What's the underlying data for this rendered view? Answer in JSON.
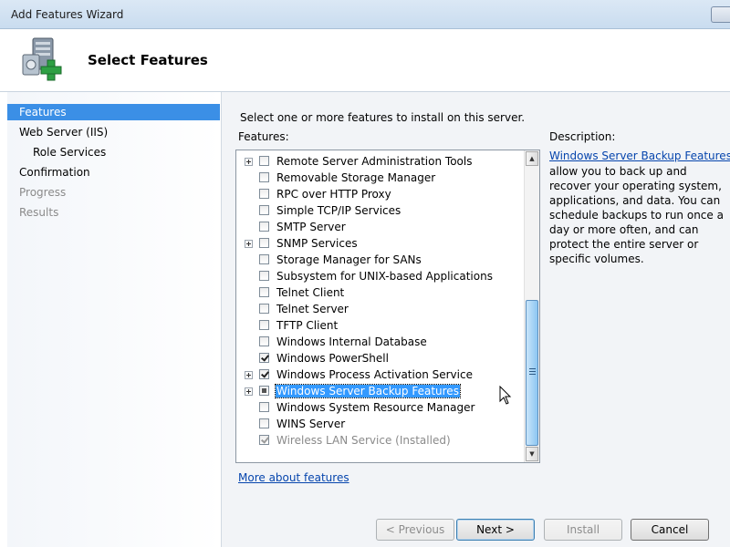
{
  "window": {
    "title": "Add Features Wizard"
  },
  "header": {
    "title": "Select Features",
    "icon": "server-add-icon"
  },
  "nav": {
    "items": [
      {
        "label": "Features",
        "state": "selected"
      },
      {
        "label": "Web Server (IIS)",
        "state": "normal"
      },
      {
        "label": "Role Services",
        "state": "normal"
      },
      {
        "label": "Confirmation",
        "state": "normal"
      },
      {
        "label": "Progress",
        "state": "disabled"
      },
      {
        "label": "Results",
        "state": "disabled"
      }
    ]
  },
  "main": {
    "instruction": "Select one or more features to install on this server.",
    "features_label": "Features:",
    "features": [
      {
        "label": "Remote Server Administration Tools",
        "expandable": true,
        "state": "unchecked"
      },
      {
        "label": "Removable Storage Manager",
        "expandable": false,
        "state": "unchecked"
      },
      {
        "label": "RPC over HTTP Proxy",
        "expandable": false,
        "state": "unchecked"
      },
      {
        "label": "Simple TCP/IP Services",
        "expandable": false,
        "state": "unchecked"
      },
      {
        "label": "SMTP Server",
        "expandable": false,
        "state": "unchecked"
      },
      {
        "label": "SNMP Services",
        "expandable": true,
        "state": "unchecked"
      },
      {
        "label": "Storage Manager for SANs",
        "expandable": false,
        "state": "unchecked"
      },
      {
        "label": "Subsystem for UNIX-based Applications",
        "expandable": false,
        "state": "unchecked"
      },
      {
        "label": "Telnet Client",
        "expandable": false,
        "state": "unchecked"
      },
      {
        "label": "Telnet Server",
        "expandable": false,
        "state": "unchecked"
      },
      {
        "label": "TFTP Client",
        "expandable": false,
        "state": "unchecked"
      },
      {
        "label": "Windows Internal Database",
        "expandable": false,
        "state": "unchecked"
      },
      {
        "label": "Windows PowerShell",
        "expandable": false,
        "state": "checked"
      },
      {
        "label": "Windows Process Activation Service",
        "expandable": true,
        "state": "checked"
      },
      {
        "label": "Windows Server Backup Features",
        "expandable": true,
        "state": "partial",
        "selected": true
      },
      {
        "label": "Windows System Resource Manager",
        "expandable": false,
        "state": "unchecked"
      },
      {
        "label": "WINS Server",
        "expandable": false,
        "state": "unchecked"
      },
      {
        "label": "Wireless LAN Service  (Installed)",
        "expandable": false,
        "state": "checked-disabled"
      }
    ],
    "more_link": "More about features"
  },
  "description": {
    "label": "Description:",
    "link": "Windows Server Backup Features",
    "text": "allow you to back up and recover your operating system, applications, and data. You can schedule backups to run once a day or more often, and can protect the entire server or specific volumes."
  },
  "buttons": {
    "previous": "< Previous",
    "next": "Next >",
    "install": "Install",
    "cancel": "Cancel"
  },
  "colors": {
    "selection": "#3399ff",
    "nav_selected": "#3b8fe6",
    "link": "#0645ad"
  }
}
